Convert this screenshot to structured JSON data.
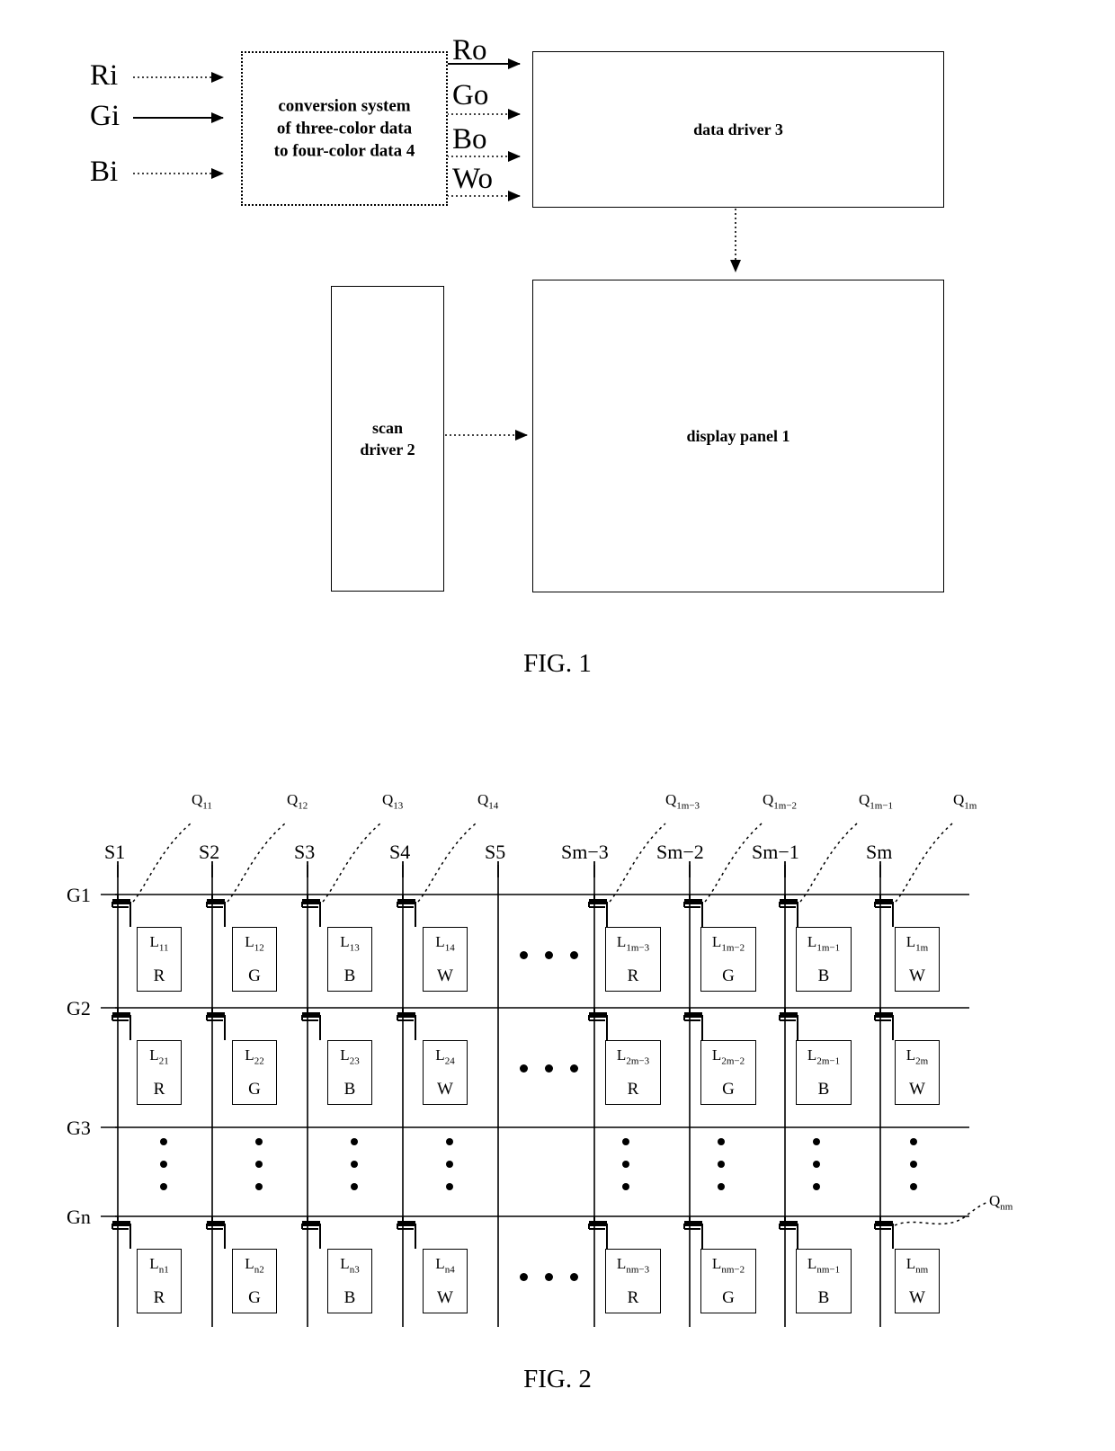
{
  "figure1": {
    "caption": "FIG. 1",
    "inputs": [
      {
        "label": "Ri",
        "style": "dotted"
      },
      {
        "label": "Gi",
        "style": "solid"
      },
      {
        "label": "Bi",
        "style": "dotted"
      }
    ],
    "conversion_block": {
      "lines": [
        "conversion system",
        "of three-color data",
        "to four-color data 4"
      ],
      "border": "dotted"
    },
    "outputs": [
      {
        "label": "Ro",
        "style": "solid"
      },
      {
        "label": "Go",
        "style": "dotted"
      },
      {
        "label": "Bo",
        "style": "dotted"
      },
      {
        "label": "Wo",
        "style": "dotted"
      }
    ],
    "data_driver": {
      "label": "data driver 3"
    },
    "scan_driver": {
      "lines": [
        "scan",
        "driver 2"
      ]
    },
    "display_panel": {
      "label": "display panel 1"
    }
  },
  "figure2": {
    "caption": "FIG. 2",
    "gate_labels": [
      "G1",
      "G2",
      "G3",
      "Gn"
    ],
    "source_labels": [
      "S1",
      "S2",
      "S3",
      "S4",
      "S5",
      "Sm−3",
      "Sm−2",
      "Sm−1",
      "Sm"
    ],
    "q_labels_top": [
      {
        "base": "Q",
        "sub": "11"
      },
      {
        "base": "Q",
        "sub": "12"
      },
      {
        "base": "Q",
        "sub": "13"
      },
      {
        "base": "Q",
        "sub": "14"
      },
      {
        "base": "Q",
        "sub": "1m−3"
      },
      {
        "base": "Q",
        "sub": "1m−2"
      },
      {
        "base": "Q",
        "sub": "1m−1"
      },
      {
        "base": "Q",
        "sub": "1m"
      }
    ],
    "q_label_bottom": {
      "base": "Q",
      "sub": "nm"
    },
    "rows": [
      {
        "row_id": "G1",
        "cells": [
          {
            "base": "L",
            "sub": "11",
            "color": "R"
          },
          {
            "base": "L",
            "sub": "12",
            "color": "G"
          },
          {
            "base": "L",
            "sub": "13",
            "color": "B"
          },
          {
            "base": "L",
            "sub": "14",
            "color": "W"
          },
          {
            "base": "L",
            "sub": "1m−3",
            "color": "R"
          },
          {
            "base": "L",
            "sub": "1m−2",
            "color": "G"
          },
          {
            "base": "L",
            "sub": "1m−1",
            "color": "B"
          },
          {
            "base": "L",
            "sub": "1m",
            "color": "W"
          }
        ]
      },
      {
        "row_id": "G2",
        "cells": [
          {
            "base": "L",
            "sub": "21",
            "color": "R"
          },
          {
            "base": "L",
            "sub": "22",
            "color": "G"
          },
          {
            "base": "L",
            "sub": "23",
            "color": "B"
          },
          {
            "base": "L",
            "sub": "24",
            "color": "W"
          },
          {
            "base": "L",
            "sub": "2m−3",
            "color": "R"
          },
          {
            "base": "L",
            "sub": "2m−2",
            "color": "G"
          },
          {
            "base": "L",
            "sub": "2m−1",
            "color": "B"
          },
          {
            "base": "L",
            "sub": "2m",
            "color": "W"
          }
        ]
      },
      {
        "row_id": "Gn",
        "cells": [
          {
            "base": "L",
            "sub": "n1",
            "color": "R"
          },
          {
            "base": "L",
            "sub": "n2",
            "color": "G"
          },
          {
            "base": "L",
            "sub": "n3",
            "color": "B"
          },
          {
            "base": "L",
            "sub": "n4",
            "color": "W"
          },
          {
            "base": "L",
            "sub": "nm−3",
            "color": "R"
          },
          {
            "base": "L",
            "sub": "nm−2",
            "color": "G"
          },
          {
            "base": "L",
            "sub": "nm−1",
            "color": "B"
          },
          {
            "base": "L",
            "sub": "nm",
            "color": "W"
          }
        ]
      }
    ],
    "ellipsis_horizontal": "• • •",
    "ellipsis_vertical": "•"
  },
  "colors": {
    "ink": "#000000",
    "paper": "#ffffff"
  }
}
